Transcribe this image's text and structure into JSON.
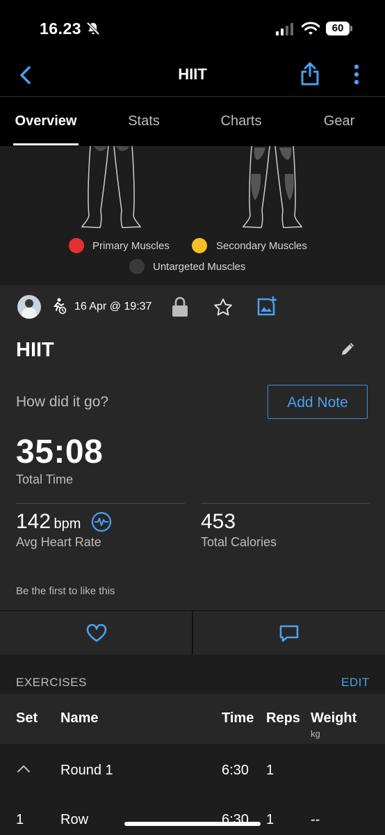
{
  "status_bar": {
    "time": "16.23",
    "battery": "60"
  },
  "nav": {
    "title": "HIIT"
  },
  "tabs": [
    {
      "label": "Overview"
    },
    {
      "label": "Stats"
    },
    {
      "label": "Charts"
    },
    {
      "label": "Gear"
    }
  ],
  "legend": {
    "primary": "Primary Muscles",
    "secondary": "Secondary Muscles",
    "untargeted": "Untargeted Muscles",
    "colors": {
      "primary": "#e53030",
      "secondary": "#f5c026",
      "untargeted": "#3a3a3a"
    }
  },
  "activity": {
    "date": "16 Apr @ 19:37",
    "title": "HIIT",
    "prompt": "How did it go?",
    "add_note": "Add Note",
    "total_time": "35:08",
    "total_time_label": "Total Time",
    "heart_rate": "142",
    "heart_rate_unit": "bpm",
    "heart_rate_label": "Avg Heart Rate",
    "calories": "453",
    "calories_label": "Total Calories",
    "likes_text": "Be the first to like this"
  },
  "exercises": {
    "title": "EXERCISES",
    "edit": "EDIT",
    "columns": {
      "set": "Set",
      "name": "Name",
      "time": "Time",
      "reps": "Reps",
      "weight": "Weight",
      "weight_unit": "kg"
    },
    "rows": [
      {
        "set": "",
        "name": "Round 1",
        "time": "6:30",
        "reps": "1",
        "weight": ""
      },
      {
        "set": "1",
        "name": "Row",
        "time": "6:30",
        "reps": "1",
        "weight": "--"
      }
    ]
  },
  "accent_color": "#4aa0f0"
}
